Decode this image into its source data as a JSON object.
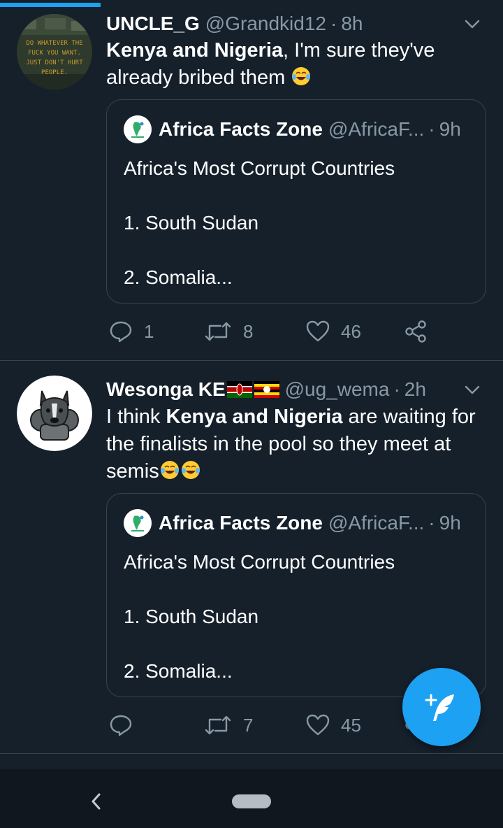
{
  "colors": {
    "background": "#15202b",
    "accent": "#1da1f2",
    "secondary_text": "#8899a6",
    "border": "#38444d"
  },
  "scroll_progress": 0.2,
  "tweets": [
    {
      "name": "UNCLE_G",
      "handle": "@Grandkid12",
      "separator": "·",
      "time": "8h",
      "avatar_text": [
        "DO WHATEVER THE",
        "FUCK YOU WANT.",
        "JUST DON'T HURT",
        "PEOPLE."
      ],
      "body_bold": "Kenya and Nigeria",
      "body_rest_line1": ", I'm sure they've",
      "body_line2": "already bribed them",
      "emoji": "face-with-tears-of-joy",
      "quote": {
        "name": "Africa Facts Zone",
        "handle": "@AfricaF...",
        "separator": "·",
        "time": "9h",
        "line1": "Africa's Most Corrupt Countries",
        "line2": "1. South Sudan",
        "line3": "2. Somalia..."
      },
      "reply_count": "1",
      "retweet_count": "8",
      "like_count": "46"
    },
    {
      "name": "Wesonga KE",
      "flags": [
        "kenya-flag",
        "uganda-flag"
      ],
      "handle": "@ug_wema",
      "separator": "·",
      "time": "2h",
      "body_pre": "I think ",
      "body_bold": "Kenya and Nigeria",
      "body_post": " are waiting for",
      "body_line2": "the finalists in the pool so they meet at",
      "body_line3": "semis",
      "emoji": "face-with-tears-of-joy",
      "quote": {
        "name": "Africa Facts Zone",
        "handle": "@AfricaF...",
        "separator": "·",
        "time": "9h",
        "line1": "Africa's Most Corrupt Countries",
        "line2": "1. South Sudan",
        "line3": "2. Somalia..."
      },
      "reply_count": "",
      "retweet_count": "7",
      "like_count": "45"
    }
  ],
  "icons": {
    "reply": "reply-icon",
    "retweet": "retweet-icon",
    "like": "heart-icon",
    "share": "share-icon",
    "compose": "compose-tweet-icon",
    "caret": "chevron-down-icon",
    "back": "back-icon"
  }
}
